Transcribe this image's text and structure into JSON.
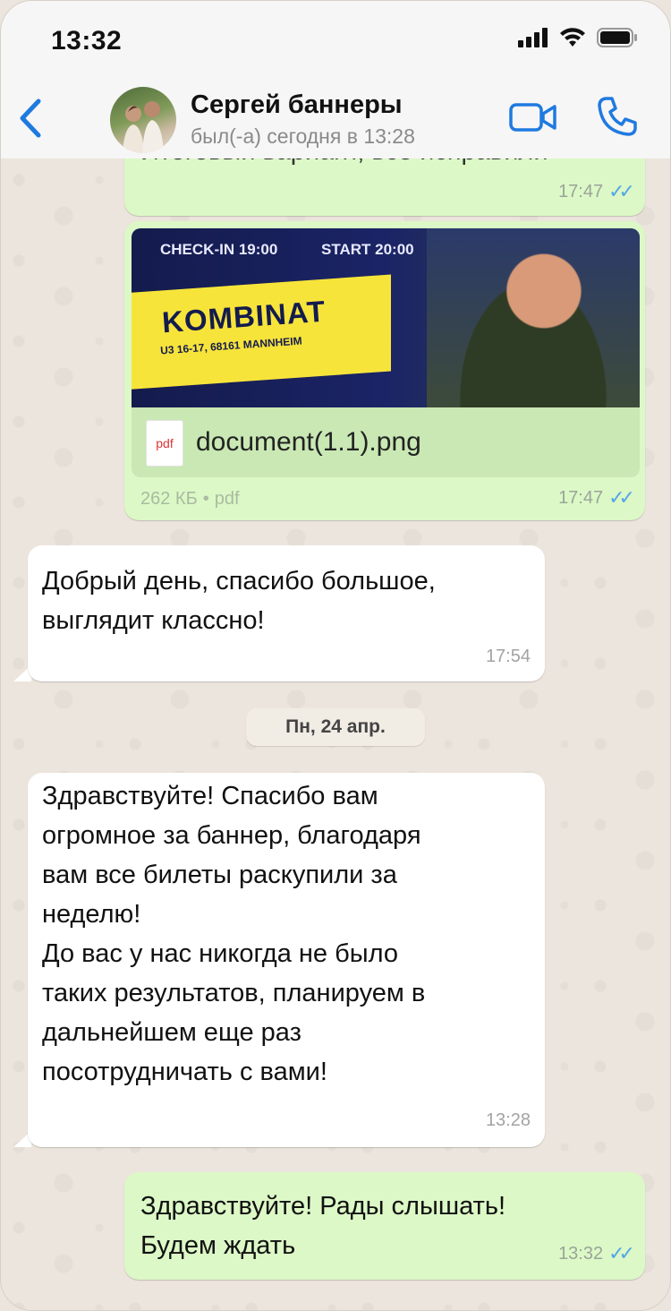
{
  "status_bar": {
    "time": "13:32"
  },
  "header": {
    "contact_name": "Сергей баннеры",
    "contact_status": "был(-а) сегодня в 13:28"
  },
  "messages": [
    {
      "direction": "out",
      "partial_text": "Итоговый вариант, все исправили",
      "time": "17:47",
      "read": true
    },
    {
      "direction": "out",
      "type": "document",
      "banner": {
        "checkin": "CHECK-IN 19:00",
        "start": "START 20:00",
        "title": "KOMBINAT",
        "address": "U3 16-17, 68161 MANNHEIM"
      },
      "file_icon_label": "pdf",
      "file_name": "document(1.1).png",
      "file_size": "262 КБ",
      "file_type": "pdf",
      "time": "17:47",
      "read": true
    },
    {
      "direction": "in",
      "text_lines": [
        "Добрый день, спасибо большое,",
        "выглядит классно!"
      ],
      "time": "17:54"
    },
    {
      "direction": "in",
      "text_lines": [
        "Здравствуйте! Спасибо вам",
        "огромное за баннер, благодаря",
        "вам все билеты раскупили за",
        "неделю!",
        "До вас у нас никогда не было",
        "таких результатов, планируем в",
        "дальнейшем еще раз",
        "посотрудничать с вами!"
      ],
      "time": "13:28"
    },
    {
      "direction": "out",
      "text_lines": [
        "Здравствуйте! Рады слышать!",
        "Будем ждать"
      ],
      "time": "13:32",
      "read": true
    }
  ],
  "date_separator": "Пн, 24 апр.",
  "colors": {
    "outgoing": "#dcf8c6",
    "incoming": "#ffffff",
    "accent": "#1f7ae0",
    "read_ticks": "#53a6e8"
  },
  "icons": [
    "back-chevron-icon",
    "video-call-icon",
    "phone-icon",
    "signal-icon",
    "wifi-icon",
    "battery-icon",
    "pdf-file-icon",
    "double-check-icon"
  ]
}
